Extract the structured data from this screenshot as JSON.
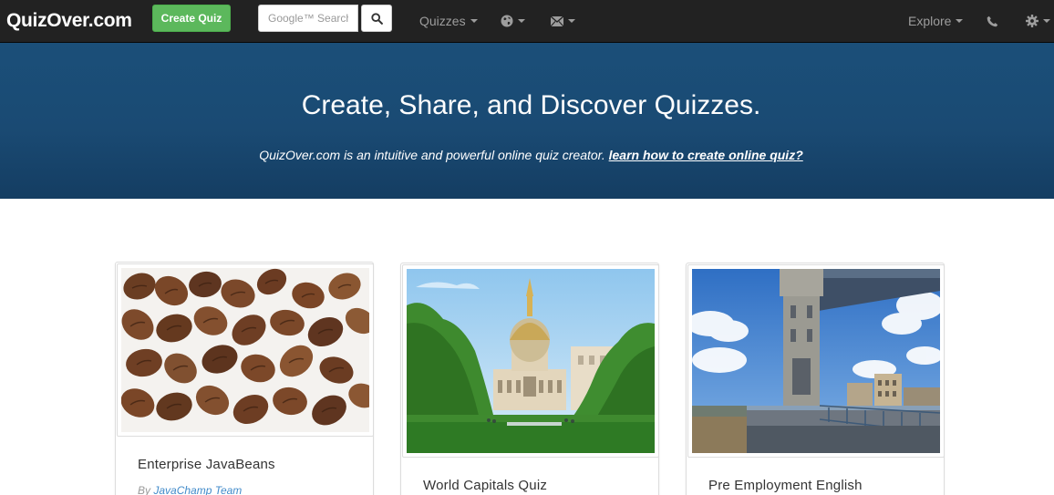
{
  "navbar": {
    "brand": "QuizOver.com",
    "create_quiz_label": "Create Quiz",
    "search_placeholder": "Google™ Search",
    "quizzes_label": "Quizzes",
    "explore_label": "Explore",
    "icons": {
      "search": "search-icon",
      "globe": "globe-icon",
      "mail": "envelope-icon",
      "phone": "phone-icon",
      "gear": "gear-icon"
    }
  },
  "hero": {
    "title": "Create, Share, and Discover Quizzes.",
    "subtitle": "QuizOver.com is an intuitive and powerful online quiz creator.",
    "link_text": "learn how to create online quiz?"
  },
  "cards": [
    {
      "title": "Enterprise JavaBeans",
      "by_prefix": "By",
      "author": "JavaChamp Team",
      "image": "coffee-beans"
    },
    {
      "title": "World Capitals Quiz",
      "image": "paris-les-invalides"
    },
    {
      "title": "Pre Employment English",
      "image": "tower-bridge"
    }
  ],
  "colors": {
    "navbar": "#222222",
    "create_button": "#5cb85c",
    "hero": "#1a4a73",
    "link": "#428bca"
  }
}
